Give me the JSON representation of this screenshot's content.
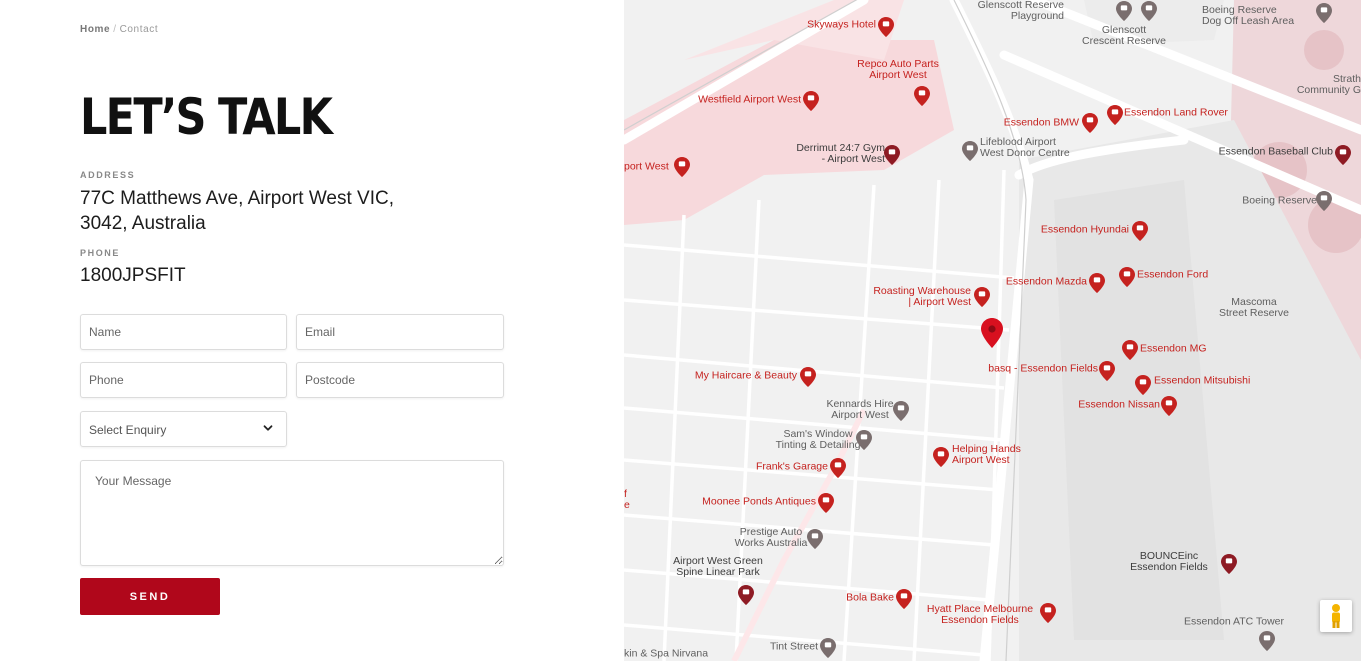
{
  "breadcrumb": {
    "home": "Home",
    "separator": "/",
    "current": "Contact"
  },
  "title": "LET’S TALK",
  "address": {
    "label": "ADDRESS",
    "line1": "77C Matthews Ave, Airport West VIC,",
    "line2": "3042, Australia"
  },
  "phone": {
    "label": "PHONE",
    "value": "1800JPSFIT"
  },
  "form": {
    "name_placeholder": "Name",
    "email_placeholder": "Email",
    "phone_placeholder": "Phone",
    "postcode_placeholder": "Postcode",
    "enquiry_selected": "Select Enquiry",
    "message_placeholder": "Your Message",
    "send_label": "SEND"
  },
  "colors": {
    "accent": "#b0071b",
    "poi_red": "#c5221f",
    "map_bg": "#f1f1f1",
    "park_pink": "#f5d3d6"
  },
  "map": {
    "pois": [
      {
        "id": "glenscott-reserve-playground",
        "l1": "Glenscott Reserve",
        "l2": "Playground",
        "icon": "tree-icon",
        "color": "gray"
      },
      {
        "id": "glenscott-crescent-reserve",
        "l1": "Glenscott",
        "l2": "Crescent Reserve",
        "icon": "tree-icon",
        "color": "gray"
      },
      {
        "id": "boeing-reserve-dog",
        "l1": "Boeing Reserve",
        "l2": "Dog Off Leash Area",
        "icon": "tree-icon",
        "color": "gray"
      },
      {
        "id": "strath-community",
        "l1": "Strath",
        "l2": "Community G",
        "icon": "",
        "color": "gray"
      },
      {
        "id": "skyways-hotel",
        "l1": "Skyways Hotel",
        "l2": "",
        "icon": "cocktail-icon",
        "color": "red"
      },
      {
        "id": "repco",
        "l1": "Repco Auto Parts",
        "l2": "Airport West",
        "icon": "shopping-bag-icon",
        "color": "red"
      },
      {
        "id": "westfield",
        "l1": "Westfield Airport West",
        "l2": "",
        "icon": "shopping-bag-icon",
        "color": "red"
      },
      {
        "id": "essendon-bmw",
        "l1": "Essendon BMW",
        "l2": "",
        "icon": "shopping-bag-icon",
        "color": "red"
      },
      {
        "id": "essendon-land-rover",
        "l1": "Essendon Land Rover",
        "l2": "",
        "icon": "shopping-bag-icon",
        "color": "red"
      },
      {
        "id": "derrimut",
        "l1": "Derrimut 24:7 Gym",
        "l2": "- Airport West",
        "icon": "location-pin-icon",
        "color": "dark"
      },
      {
        "id": "lifeblood",
        "l1": "Lifeblood Airport",
        "l2": "West Donor Centre",
        "icon": "location-pin-icon",
        "color": "gray"
      },
      {
        "id": "essendon-baseball",
        "l1": "Essendon Baseball Club",
        "l2": "",
        "icon": "location-pin-icon",
        "color": "dark"
      },
      {
        "id": "airport-west-left",
        "l1": "port West",
        "l2": "",
        "icon": "shopping-bag-icon",
        "color": "red"
      },
      {
        "id": "boeing-reserve",
        "l1": "Boeing Reserve",
        "l2": "",
        "icon": "tree-icon",
        "color": "gray"
      },
      {
        "id": "essendon-hyundai",
        "l1": "Essendon Hyundai",
        "l2": "",
        "icon": "shopping-bag-icon",
        "color": "red"
      },
      {
        "id": "essendon-mazda",
        "l1": "Essendon Mazda",
        "l2": "",
        "icon": "shopping-bag-icon",
        "color": "red"
      },
      {
        "id": "essendon-ford",
        "l1": "Essendon Ford",
        "l2": "",
        "icon": "shopping-bag-icon",
        "color": "red"
      },
      {
        "id": "roasting-warehouse",
        "l1": "Roasting Warehouse",
        "l2": "| Airport West",
        "icon": "shopping-bag-icon",
        "color": "red"
      },
      {
        "id": "mascoma",
        "l1": "Mascoma",
        "l2": "Street Reserve",
        "icon": "",
        "color": "gray"
      },
      {
        "id": "essendon-mg",
        "l1": "Essendon MG",
        "l2": "",
        "icon": "shopping-bag-icon",
        "color": "red"
      },
      {
        "id": "basq",
        "l1": "basq - Essendon Fields",
        "l2": "",
        "icon": "restaurant-icon",
        "color": "red"
      },
      {
        "id": "my-haircare",
        "l1": "My Haircare & Beauty",
        "l2": "",
        "icon": "shopping-bag-icon",
        "color": "red"
      },
      {
        "id": "essendon-mitsubishi",
        "l1": "Essendon Mitsubishi",
        "l2": "",
        "icon": "shopping-bag-icon",
        "color": "red"
      },
      {
        "id": "essendon-nissan",
        "l1": "Essendon Nissan",
        "l2": "",
        "icon": "shopping-bag-icon",
        "color": "red"
      },
      {
        "id": "kennards",
        "l1": "Kennards Hire",
        "l2": "Airport West",
        "icon": "location-pin-icon",
        "color": "gray"
      },
      {
        "id": "sams-window",
        "l1": "Sam's Window",
        "l2": "Tinting & Detailing",
        "icon": "location-pin-icon",
        "color": "gray"
      },
      {
        "id": "helping-hands",
        "l1": "Helping Hands",
        "l2": "Airport West",
        "icon": "shopping-bag-icon",
        "color": "red"
      },
      {
        "id": "franks-garage",
        "l1": "Frank's Garage",
        "l2": "",
        "icon": "shopping-bag-icon",
        "color": "red"
      },
      {
        "id": "moonee-ponds",
        "l1": "Moonee Ponds Antiques",
        "l2": "",
        "icon": "shopping-bag-icon",
        "color": "red"
      },
      {
        "id": "prestige-auto",
        "l1": "Prestige Auto",
        "l2": "Works Australia",
        "icon": "location-pin-icon",
        "color": "gray"
      },
      {
        "id": "bounceinc",
        "l1": "BOUNCEinc",
        "l2": "Essendon Fields",
        "icon": "location-pin-icon",
        "color": "dark"
      },
      {
        "id": "airport-west-green",
        "l1": "Airport West Green",
        "l2": "Spine Linear Park",
        "icon": "tree-icon",
        "color": "dark"
      },
      {
        "id": "bola-bake",
        "l1": "Bola Bake",
        "l2": "",
        "icon": "cafe-icon",
        "color": "red"
      },
      {
        "id": "hyatt",
        "l1": "Hyatt Place Melbourne",
        "l2": "Essendon Fields",
        "icon": "hotel-icon",
        "color": "red"
      },
      {
        "id": "essendon-atc",
        "l1": "Essendon ATC Tower",
        "l2": "",
        "icon": "location-pin-icon",
        "color": "gray"
      },
      {
        "id": "tint-street",
        "l1": "Tint Street",
        "l2": "",
        "icon": "location-pin-icon",
        "color": "gray"
      },
      {
        "id": "skin-spa",
        "l1": "kin & Spa Nirvana",
        "l2": "",
        "icon": "",
        "color": "gray"
      },
      {
        "id": "partial-f",
        "l1": "f",
        "l2": "e",
        "icon": "",
        "color": "red"
      }
    ]
  }
}
